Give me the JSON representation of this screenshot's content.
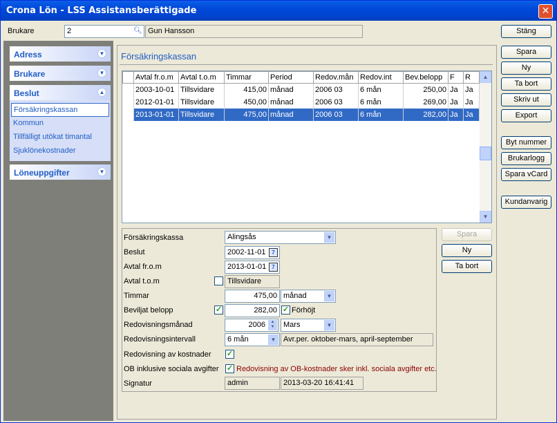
{
  "window": {
    "title": "Crona Lön - LSS Assistansberättigade",
    "close": "✕"
  },
  "top": {
    "brukare_label": "Brukare",
    "brukare_id": "2",
    "brukare_name": "Gun Hansson"
  },
  "nav": {
    "adress": "Adress",
    "brukare": "Brukare",
    "beslut": "Beslut",
    "beslut_items": [
      "Försäkringskassan",
      "Kommun",
      "Tillfälligt utökat timantal",
      "Sjuklönekostnader"
    ],
    "loneuppgifter": "Löneuppgifter"
  },
  "section_title": "Försäkringskassan",
  "table": {
    "headers": [
      "Avtal fr.o.m",
      "Avtal t.o.m",
      "Timmar",
      "Period",
      "Redov.mån",
      "Redov.int",
      "Bev.belopp",
      "F",
      "R"
    ],
    "rows": [
      [
        "2003-10-01",
        "Tillsvidare",
        "415,00",
        "månad",
        "2006 03",
        "6 mån",
        "250,00",
        "Ja",
        "Ja"
      ],
      [
        "2012-01-01",
        "Tillsvidare",
        "450,00",
        "månad",
        "2006 03",
        "6 mån",
        "269,00",
        "Ja",
        "Ja"
      ],
      [
        "2013-01-01",
        "Tillsvidare",
        "475,00",
        "månad",
        "2006 03",
        "6 mån",
        "282,00",
        "Ja",
        "Ja"
      ]
    ]
  },
  "form": {
    "forsakringskassa_label": "Försäkringskassa",
    "forsakringskassa": "Alingsås",
    "beslut_label": "Beslut",
    "beslut": "2002-11-01",
    "avtal_from_label": "Avtal fr.o.m",
    "avtal_from": "2013-01-01",
    "avtal_tom_label": "Avtal t.o.m",
    "avtal_tom": "Tillsvidare",
    "timmar_label": "Timmar",
    "timmar": "475,00",
    "period": "månad",
    "beviljat_label": "Beviljat belopp",
    "beviljat": "282,00",
    "forhojt": "Förhöjt",
    "redovmanad_label": "Redovisningsmånad",
    "redov_ar": "2006",
    "redov_man": "Mars",
    "redovint_label": "Redovisningsintervall",
    "redovint": "6 mån",
    "redovint_desc": "Avr.per. oktober-mars, april-september",
    "redovkost_label": "Redovisning av kostnader",
    "ob_label": "OB inklusive sociala avgifter",
    "ob_text": "Redovisning av OB-kostnader sker inkl. sociala avgifter etc.",
    "signatur_label": "Signatur",
    "signatur_user": "admin",
    "signatur_time": "2013-03-20 16:41:41"
  },
  "form_buttons": {
    "spara": "Spara",
    "ny": "Ny",
    "ta_bort": "Ta bort"
  },
  "right_buttons": {
    "stang": "Stäng",
    "spara": "Spara",
    "ny": "Ny",
    "ta_bort": "Ta bort",
    "skriv_ut": "Skriv ut",
    "export": "Export",
    "byt_nummer": "Byt nummer",
    "brukarlogg": "Brukarlogg",
    "spara_vcard": "Spara vCard",
    "kundanvarig": "Kundanvarig"
  },
  "colors": {
    "selection": "#316ac5",
    "titlebar": "#0149d8",
    "ob_text": "#8b0000"
  }
}
